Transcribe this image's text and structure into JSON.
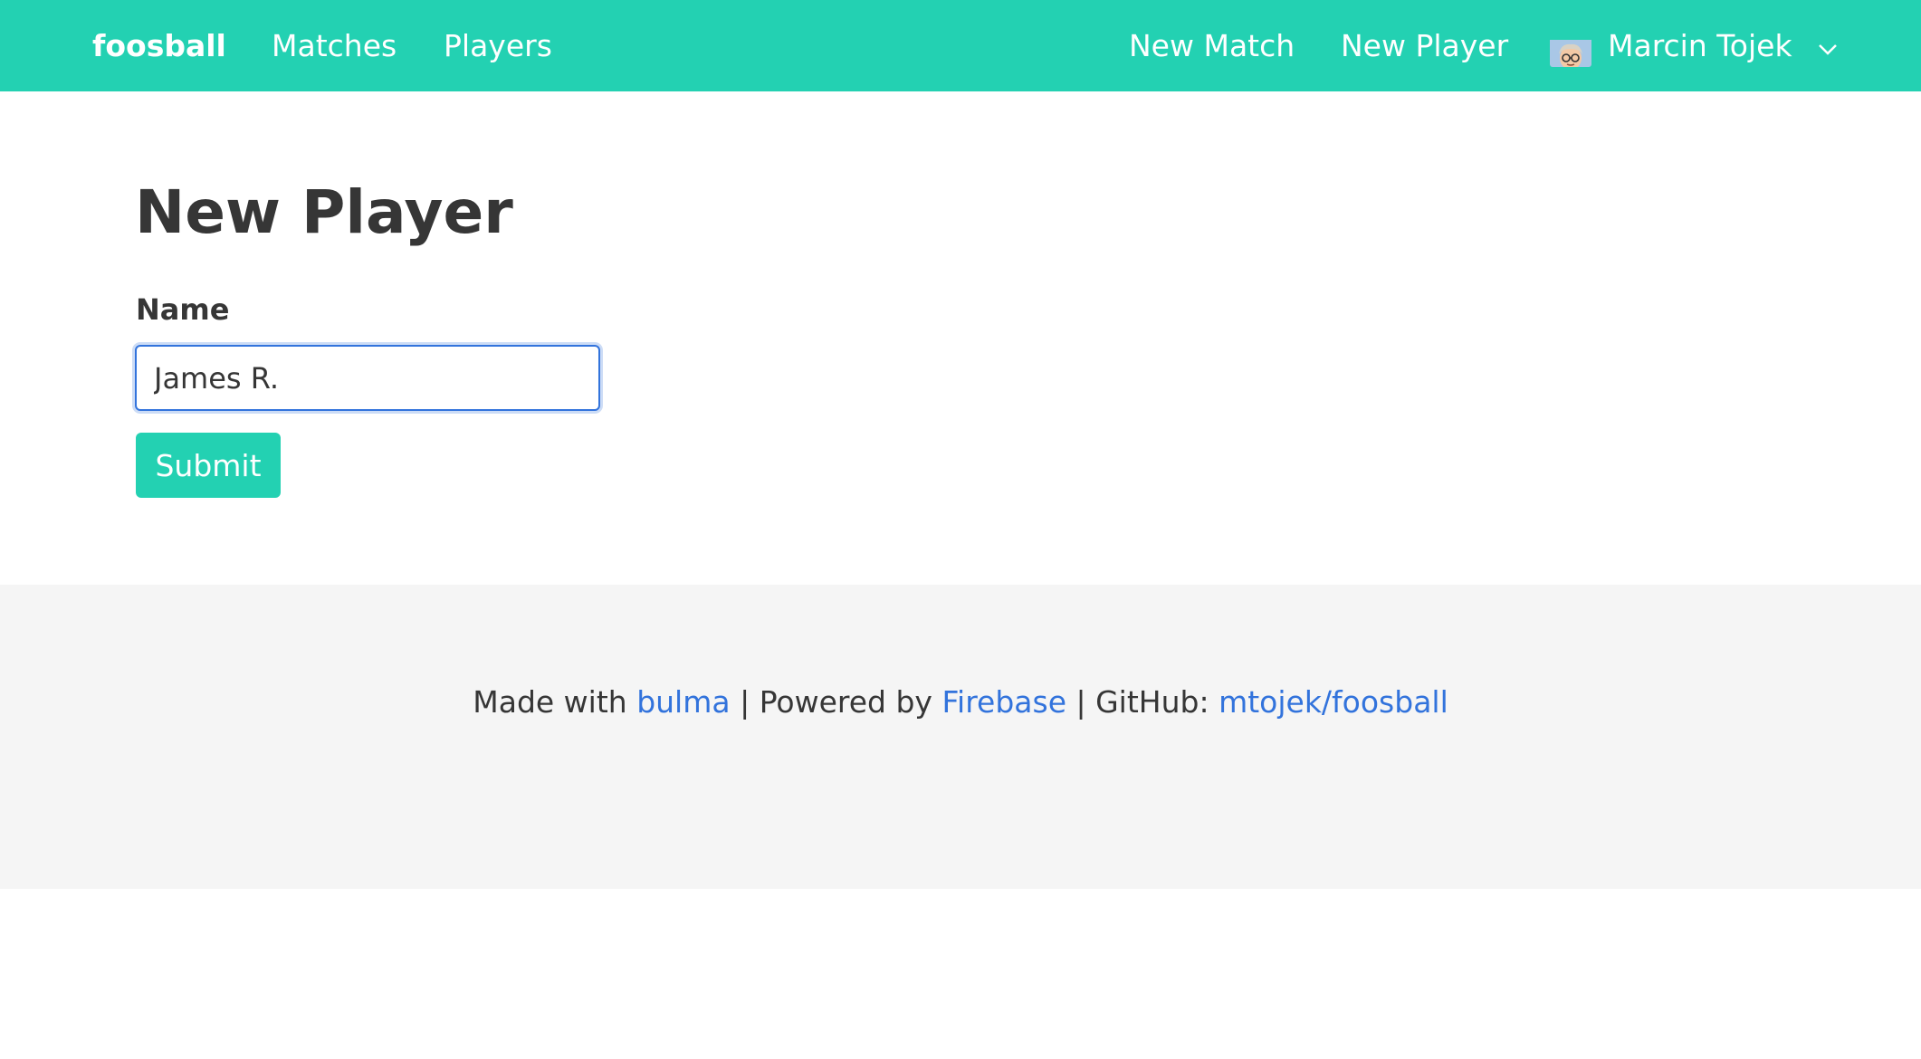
{
  "navbar": {
    "brand": "foosball",
    "links": {
      "matches": "Matches",
      "players": "Players",
      "new_match": "New Match",
      "new_player": "New Player"
    },
    "user": {
      "name": "Marcin Tojek",
      "avatar_icon": "avatar-icon",
      "dropdown_icon": "chevron-down-icon"
    }
  },
  "main": {
    "title": "New Player",
    "form": {
      "name_label": "Name",
      "name_value": "James R.",
      "submit_label": "Submit"
    }
  },
  "footer": {
    "made_with_prefix": "Made with ",
    "bulma_link": "bulma",
    "powered_by_prefix": " | Powered by ",
    "firebase_link": "Firebase",
    "github_prefix": " | GitHub: ",
    "github_link": "mtojek/foosball"
  },
  "colors": {
    "primary": "#23d1b2",
    "link": "#3273dc",
    "text": "#363636",
    "footer_bg": "#f5f5f5"
  }
}
